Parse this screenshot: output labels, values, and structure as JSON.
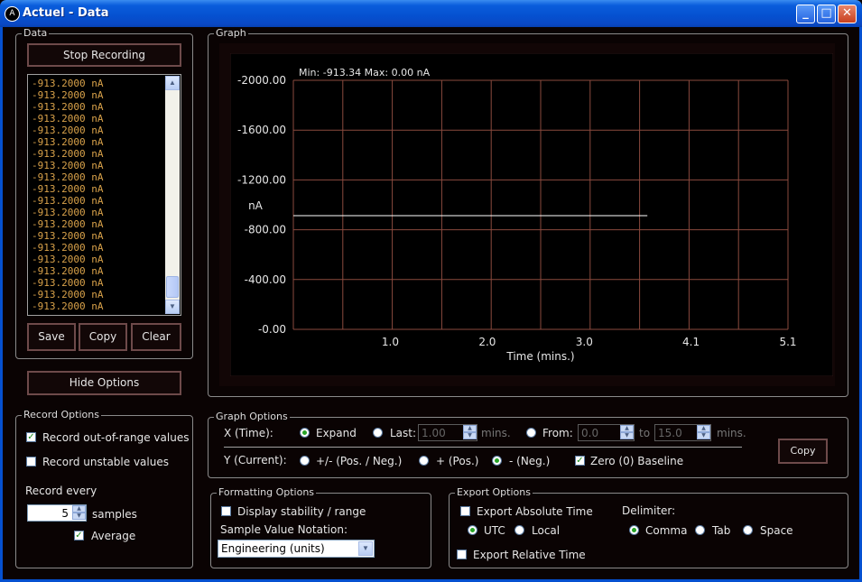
{
  "window": {
    "title": "Actuel  -  Data",
    "icon": "app-logo-icon",
    "controls": {
      "minimize": "minimize-icon",
      "maximize": "maximize-icon",
      "close": "close-icon"
    }
  },
  "data_panel": {
    "label": "Data",
    "stop_button": "Stop Recording",
    "readings": [
      "-913.2000 nA",
      "-913.2000 nA",
      "-913.2000 nA",
      "-913.2000 nA",
      "-913.2000 nA",
      "-913.2000 nA",
      "-913.2000 nA",
      "-913.2000 nA",
      "-913.2000 nA",
      "-913.2000 nA",
      "-913.2000 nA",
      "-913.2000 nA",
      "-913.2000 nA",
      "-913.2000 nA",
      "-913.2000 nA",
      "-913.2000 nA",
      "-913.2000 nA",
      "-913.2000 nA",
      "-913.2000 nA",
      "-913.2000 nA"
    ],
    "save_button": "Save",
    "copy_button": "Copy",
    "clear_button": "Clear",
    "scroll_position": 0.92
  },
  "hide_options_button": "Hide Options",
  "graph_panel": {
    "label": "Graph",
    "stats_text": "Min: -913.34   Max: 0.00 nA"
  },
  "chart_data": {
    "type": "line",
    "xlabel": "Time (mins.)",
    "ylabel": "nA",
    "x_ticks": [
      "1.0",
      "2.0",
      "3.0",
      "4.1",
      "5.1"
    ],
    "y_ticks": [
      "-2000.00",
      "-1600.00",
      "-1200.00",
      "-800.00",
      "-400.00",
      "-0.00"
    ],
    "xlim": [
      0,
      5.1
    ],
    "ylim": [
      -2000,
      0
    ],
    "y_axis_reversed": true,
    "grid": true,
    "grid_color": "#8a4a3e",
    "line_color": "#ffffff",
    "series": [
      {
        "x": [
          0,
          3.65
        ],
        "y": [
          -913.2,
          -913.2
        ]
      }
    ]
  },
  "record_options": {
    "label": "Record Options",
    "out_of_range_label": "Record out-of-range values",
    "out_of_range_checked": true,
    "unstable_label": "Record unstable values",
    "unstable_checked": false,
    "record_every_label": "Record every",
    "record_every_value": "5",
    "samples_label": "samples",
    "average_label": "Average",
    "average_checked": true
  },
  "graph_options": {
    "label": "Graph Options",
    "x_label": "X (Time):",
    "expand_label": "Expand",
    "last_label": "Last:",
    "last_value": "1.00",
    "mins_label": "mins.",
    "from_label": "From:",
    "from_value": "0.0",
    "to_label": "to",
    "to_value": "15.0",
    "mins_label2": "mins.",
    "x_selected": "Expand",
    "y_label": "Y (Current):",
    "posneg_label": "+/- (Pos. / Neg.)",
    "pos_label": "+ (Pos.)",
    "neg_label": "- (Neg.)",
    "y_selected": "- (Neg.)",
    "zero_label": "Zero (0) Baseline",
    "zero_checked": true,
    "copy_button": "Copy"
  },
  "formatting_options": {
    "label": "Formatting Options",
    "display_label": "Display stability / range",
    "display_checked": false,
    "notation_label": "Sample Value Notation:",
    "notation_value": "Engineering (units)"
  },
  "export_options": {
    "label": "Export Options",
    "absolute_label": "Export Absolute Time",
    "absolute_checked": false,
    "utc_label": "UTC",
    "local_label": "Local",
    "timezone_selected": "UTC",
    "delimiter_label": "Delimiter:",
    "comma_label": "Comma",
    "tab_label": "Tab",
    "space_label": "Space",
    "delimiter_selected": "Comma",
    "relative_label": "Export Relative Time",
    "relative_checked": false
  },
  "colors": {
    "accent": "#27a427",
    "list_text": "#d9a24a",
    "button_border": "#6e4a4a"
  }
}
